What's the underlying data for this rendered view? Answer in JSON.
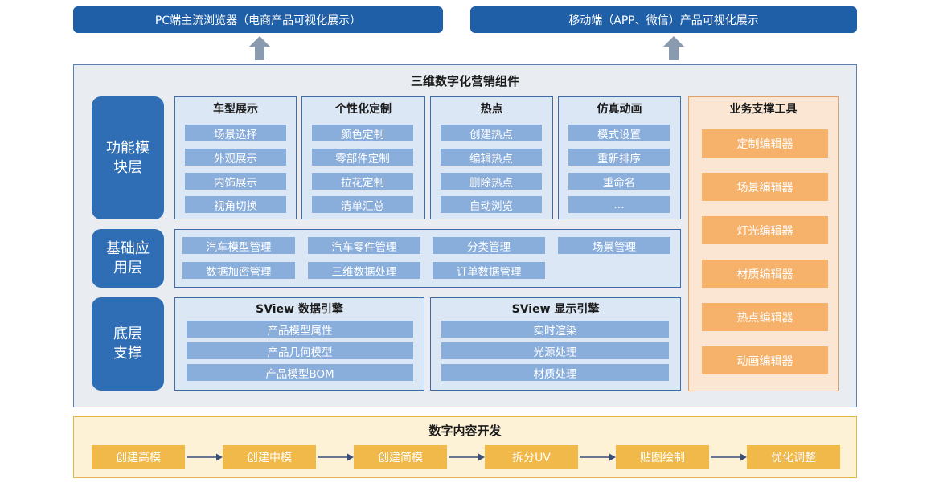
{
  "top": {
    "pc": "PC端主流浏览器（电商产品可视化展示）",
    "mobile": "移动端（APP、微信）产品可视化展示"
  },
  "main": {
    "title": "三维数字化营销组件",
    "func_label": "功能模\n块层",
    "base_label": "基础应\n用层",
    "bottom_label": "底层\n支撑",
    "func_columns": [
      {
        "title": "车型展示",
        "items": [
          "场景选择",
          "外观展示",
          "内饰展示",
          "视角切换"
        ]
      },
      {
        "title": "个性化定制",
        "items": [
          "颜色定制",
          "零部件定制",
          "拉花定制",
          "清单汇总"
        ]
      },
      {
        "title": "热点",
        "items": [
          "创建热点",
          "编辑热点",
          "删除热点",
          "自动浏览"
        ]
      },
      {
        "title": "仿真动画",
        "items": [
          "模式设置",
          "重新排序",
          "重命名",
          "…"
        ]
      }
    ],
    "base_items": [
      "汽车模型管理",
      "汽车零件管理",
      "分类管理",
      "场景管理",
      "数据加密管理",
      "三维数据处理",
      "订单数据管理"
    ],
    "engines": [
      {
        "title": "SView 数据引擎",
        "items": [
          "产品模型属性",
          "产品几何模型",
          "产品模型BOM"
        ]
      },
      {
        "title": "SView 显示引擎",
        "items": [
          "实时渲染",
          "光源处理",
          "材质处理"
        ]
      }
    ]
  },
  "biz": {
    "title": "业务支撑工具",
    "items": [
      "定制编辑器",
      "场景编辑器",
      "灯光编辑器",
      "材质编辑器",
      "热点编辑器",
      "动画编辑器"
    ]
  },
  "bottom": {
    "title": "数字内容开发",
    "steps": [
      "创建高模",
      "创建中模",
      "创建简模",
      "拆分UV",
      "贴图绘制",
      "优化调整"
    ]
  },
  "colors": {
    "dark_blue": "#1f5fa8",
    "light_blue_item": "#8aaedb",
    "orange_item": "#f6b26b",
    "yellow_step": "#f0b94a"
  }
}
